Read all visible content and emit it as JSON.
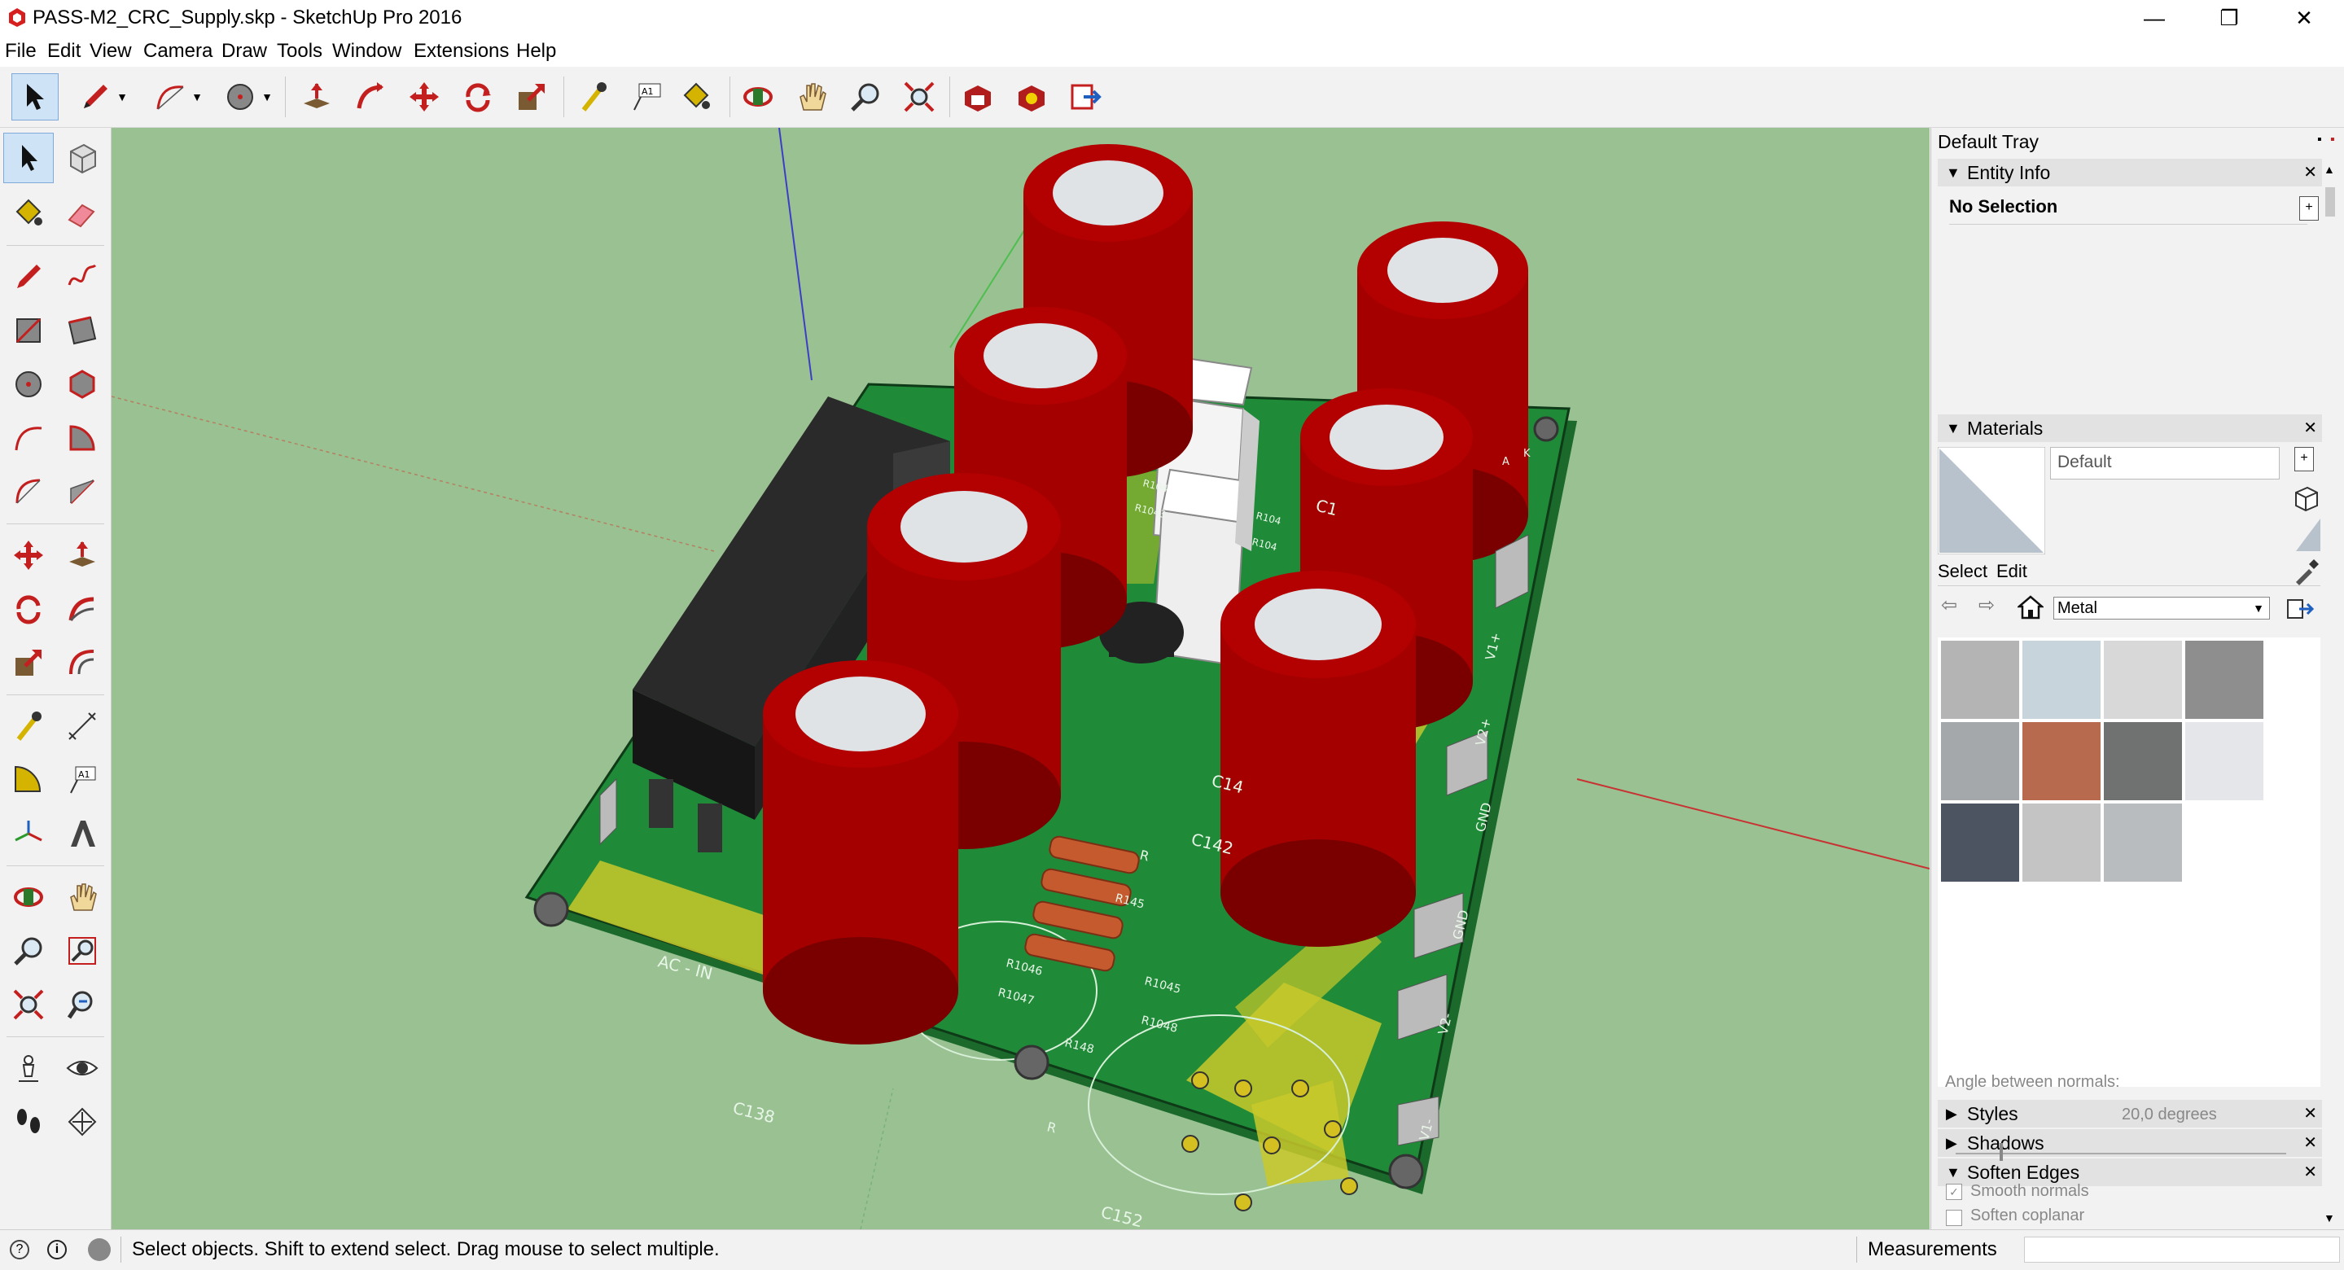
{
  "window": {
    "title": "PASS-M2_CRC_Supply.skp - SketchUp Pro 2016",
    "minimize_glyph": "—",
    "restore_glyph": "❐",
    "close_glyph": "✕"
  },
  "menu": [
    "File",
    "Edit",
    "View",
    "Camera",
    "Draw",
    "Tools",
    "Window",
    "Extensions",
    "Help"
  ],
  "toolbar": {
    "icons": [
      "select-icon",
      "pencil-icon",
      "arc-icon",
      "circle-icon",
      "push-pull-icon",
      "follow-me-icon",
      "move-icon",
      "rotate-icon",
      "scale-icon",
      "tape-measure-icon",
      "text-icon",
      "paint-bucket-icon",
      "orbit-icon",
      "pan-icon",
      "zoom-icon",
      "zoom-extents-icon",
      "warehouse-icon",
      "extension-warehouse-icon",
      "send-to-layout-icon"
    ],
    "text_tool_label": "A1"
  },
  "left_tools": {
    "icons": [
      "select-icon",
      "component-icon",
      "paint-bucket-icon",
      "eraser-icon",
      "line-icon",
      "freehand-icon",
      "rectangle-icon",
      "rotated-rectangle-icon",
      "circle-icon",
      "polygon-icon",
      "arc-icon",
      "pie-icon",
      "two-point-arc-icon",
      "three-point-arc-icon",
      "move-icon",
      "push-pull-icon",
      "rotate-icon",
      "follow-me-icon",
      "scale-icon",
      "offset-icon",
      "tape-measure-icon",
      "dimension-icon",
      "protractor-icon",
      "text-icon",
      "axes-icon",
      "3d-text-icon",
      "orbit-icon",
      "pan-icon",
      "zoom-icon",
      "zoom-window-icon",
      "zoom-extents-icon",
      "previous-view-icon",
      "position-camera-icon",
      "look-around-icon",
      "walk-icon",
      "section-plane-icon"
    ],
    "text_tool_label": "A1"
  },
  "model": {
    "silk_labels": [
      "AC - IN",
      "C138",
      "C152",
      "C142",
      "C14",
      "C1",
      "R145",
      "R1046",
      "R1047",
      "R1045",
      "R148",
      "R1048",
      "R",
      "R",
      "GND",
      "GND",
      "V2+",
      "V2-",
      "V1+",
      "V1-",
      "R104",
      "R1043",
      "R104",
      "R104",
      "A",
      "K"
    ]
  },
  "tray": {
    "title": "Default Tray",
    "entity_info": {
      "label": "Entity Info",
      "selection": "No Selection"
    },
    "materials": {
      "label": "Materials",
      "current_name": "Default",
      "tab_select": "Select",
      "tab_edit": "Edit",
      "library": "Metal",
      "swatch_colors": [
        "#b4b4b4",
        "#c8d4dc",
        "#d8d8d8",
        "#8e8e8e",
        "#a4a8aa",
        "#b86a4e",
        "#6f7270",
        "#e4e6ea",
        "#4c5462",
        "#c4c4c4",
        "#b8bcbe"
      ]
    },
    "styles": {
      "label": "Styles"
    },
    "shadows": {
      "label": "Shadows"
    },
    "soften_edges": {
      "label": "Soften Edges",
      "angle_label": "Angle between normals:",
      "angle_value": "20,0  degrees",
      "smooth_normals": "Smooth normals",
      "smooth_normals_checked": true,
      "soften_coplanar": "Soften coplanar",
      "soften_coplanar_checked": false
    }
  },
  "statusbar": {
    "message": "Select objects. Shift to extend select. Drag mouse to select multiple.",
    "measurements_label": "Measurements",
    "measurements_value": ""
  },
  "colors": {
    "viewport_bg": "#99c192",
    "pcb": "#1f8a38",
    "pcb_copper": "#c9c92a",
    "capacitor": "#a40000",
    "capacitor_top": "#d9dde0",
    "heatsink": "#1e1e1e",
    "selection_blue": "#cfe3f7"
  }
}
